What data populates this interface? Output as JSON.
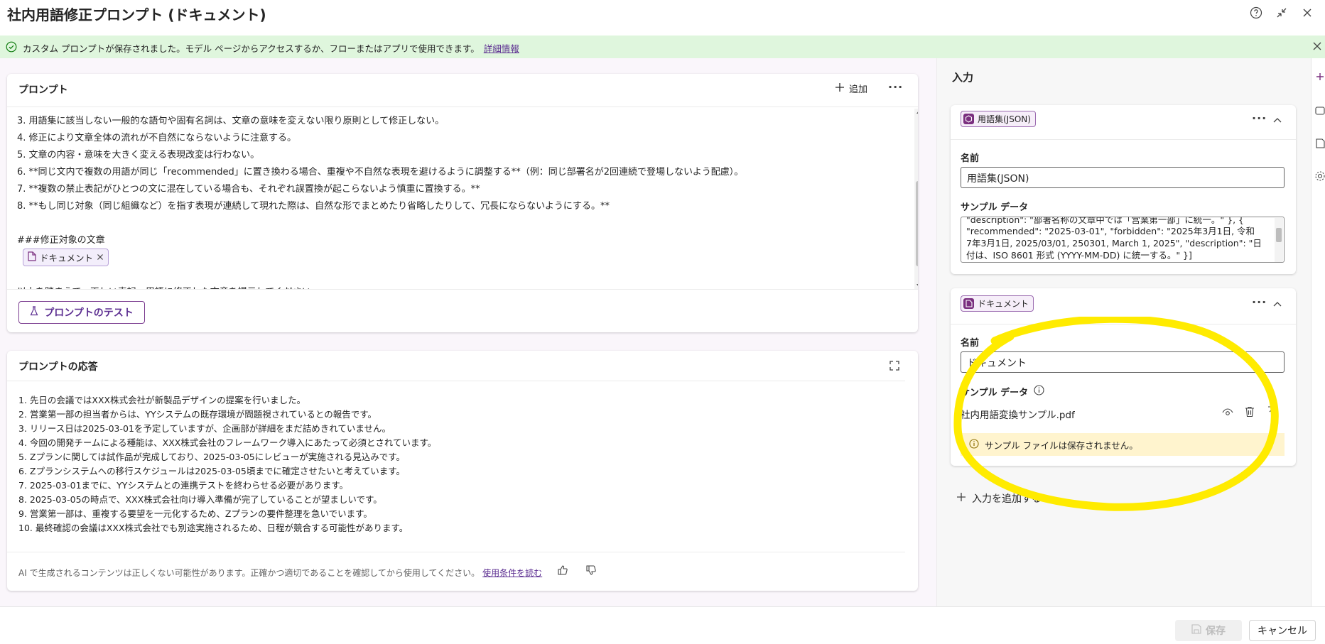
{
  "window": {
    "title": "社内用語修正プロンプト (ドキュメント)",
    "help_icon": "question-circle-icon",
    "minimize_icon": "collapse-arrows-icon",
    "close_icon": "close-icon"
  },
  "banner": {
    "message": "カスタム プロンプトが保存されました。モデル ページからアクセスするか、フローまたはアプリで使用できます。",
    "link": "詳細情報"
  },
  "prompt_card": {
    "title": "プロンプト",
    "add_label": "追加",
    "lines": [
      "3. 用語集に該当しない一般的な語句や固有名詞は、文章の意味を変えない限り原則として修正しない。",
      "4. 修正により文章全体の流れが不自然にならないように注意する。",
      "5. 文章の内容・意味を大きく変える表現改変は行わない。",
      "6. **同じ文内で複数の用語が同じ「recommended」に置き換わる場合、重複や不自然な表現を避けるように調整する**（例：同じ部署名が2回連続で登場しないよう配慮）。",
      "7. **複数の禁止表記がひとつの文に混在している場合も、それぞれ誤置換が起こらないよう慎重に置換する。**",
      "8. **もし同じ対象（同じ組織など）を指す表現が連続して現れた際は、自然な形でまとめたり省略したりして、冗長にならないようにする。**"
    ],
    "section_heading": "###修正対象の文章",
    "chip_label": "ドキュメント",
    "cut_line": "以上を踏まえて、正しい表記・用語に修正した文章を提示してください。",
    "test_button": "プロンプトのテスト"
  },
  "response_card": {
    "title": "プロンプトの応答",
    "lines": [
      "1. 先日の会議ではXXX株式会社が新製品デザインの提案を行いました。",
      "2. 営業第一部の担当者からは、YYシステムの既存環境が問題視されているとの報告です。",
      "3. リリース日は2025-03-01を予定していますが、企画部が詳細をまだ詰めきれていません。",
      "4. 今回の開発チームによる種能は、XXX株式会社のフレームワーク導入にあたって必須とされています。",
      "5. Zプランに関しては試作品が完成しており、2025-03-05にレビューが実施される見込みです。",
      "6. Zプランシステムへの移行スケジュールは2025-03-05頃までに確定させたいと考えています。",
      "7. 2025-03-01までに、YYシステムとの連携テストを終わらせる必要があります。",
      "8. 2025-03-05の時点で、XXX株式会社向け導入準備が完了していることが望ましいです。",
      "9. 営業第一部は、重複する要望を一元化するため、Zプランの要件整理を急いでいます。",
      "10. 最終確認の会議はXXX株式会社でも別途実施されるため、日程が競合する可能性があります。"
    ],
    "disclaimer": "AI で生成されるコンテンツは正しくない可能性があります。正確かつ適切であることを確認してから使用してください。",
    "terms_link": "使用条件を読む"
  },
  "input_panel": {
    "title": "入力",
    "input1": {
      "badge": "用語集(JSON)",
      "name_label": "名前",
      "name_value": "用語集(JSON)",
      "sample_label": "サンプル データ",
      "sample_lines": [
        "\"description\": \"部署名称の文章中では「営業第一部」に統一。\" }, {",
        "\"recommended\": \"2025-03-01\",    \"forbidden\": \"2025年3月1日, 令和",
        "7年3月1日, 2025/03/01, 250301, March 1, 2025\",    \"description\": \"日",
        "付は、ISO 8601 形式 (YYYY-MM-DD) に統一する。\" }]"
      ]
    },
    "input2": {
      "badge": "ドキュメント",
      "name_label": "名前",
      "name_value": "ドキュメント",
      "sample_label": "サンプル データ",
      "file_name": "社内用語変換サンプル.pdf",
      "warning": "サンプル ファイルは保存されません。"
    },
    "add_input": "入力を追加する"
  },
  "footer": {
    "save": "保存",
    "cancel": "キャンセル"
  },
  "colors": {
    "accent": "#5c2e91",
    "banner_bg": "#dff6dd",
    "highlight": "#ffeb00"
  }
}
